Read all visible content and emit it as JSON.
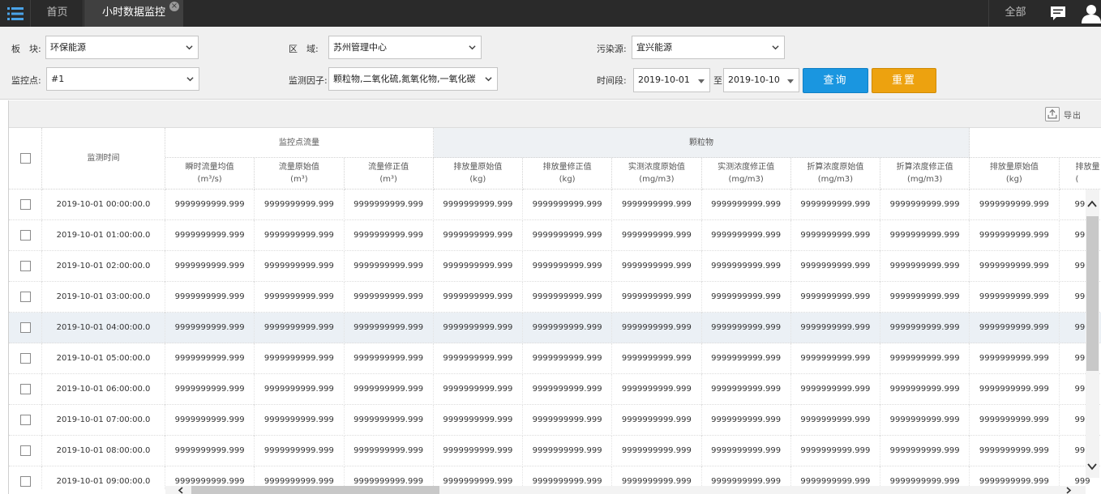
{
  "topbar": {
    "home_tab": "首页",
    "active_tab": "小时数据监控",
    "close_glyph": "×",
    "all_label": "全部",
    "menu_icon": "list-menu-icon",
    "message_icon": "message-icon",
    "user_icon": "user-icon"
  },
  "filters": {
    "board_label": "板　块:",
    "board_value": "环保能源",
    "region_label": "区　域:",
    "region_value": "苏州管理中心",
    "source_label": "污染源:",
    "source_value": "宜兴能源",
    "point_label": "监控点:",
    "point_value": "#1",
    "factor_label": "监测因子:",
    "factor_value": "颗粒物,二氧化硫,氮氧化物,一氧化碳",
    "period_label": "时间段:",
    "date_from": "2019-10-01",
    "to_label": "至",
    "date_to": "2019-10-10",
    "query_button": "查询",
    "reset_button": "重置"
  },
  "toolbar": {
    "export_label": "导出"
  },
  "table": {
    "time_header": "监测时间",
    "groups": [
      "监控点流量",
      "颗粒物"
    ],
    "columns": [
      {
        "name": "瞬时流量均值",
        "unit": "(m³/s)"
      },
      {
        "name": "流量原始值",
        "unit": "(m³)"
      },
      {
        "name": "流量修正值",
        "unit": "(m³)"
      },
      {
        "name": "排放量原始值",
        "unit": "(kg)"
      },
      {
        "name": "排放量修正值",
        "unit": "(kg)"
      },
      {
        "name": "实测浓度原始值",
        "unit": "(mg/m3)"
      },
      {
        "name": "实测浓度修正值",
        "unit": "(mg/m3)"
      },
      {
        "name": "折算浓度原始值",
        "unit": "(mg/m3)"
      },
      {
        "name": "折算浓度修正值",
        "unit": "(mg/m3)"
      },
      {
        "name": "排放量原始值",
        "unit": "(kg)"
      },
      {
        "name": "排放量",
        "unit": "("
      }
    ],
    "value": "9999999999.999",
    "partial_value": "999",
    "rows": [
      "2019-10-01 00:00:00.0",
      "2019-10-01 01:00:00.0",
      "2019-10-01 02:00:00.0",
      "2019-10-01 03:00:00.0",
      "2019-10-01 04:00:00.0",
      "2019-10-01 05:00:00.0",
      "2019-10-01 06:00:00.0",
      "2019-10-01 07:00:00.0",
      "2019-10-01 08:00:00.0",
      "2019-10-01 09:00:00.0"
    ],
    "highlighted_row": 4
  }
}
